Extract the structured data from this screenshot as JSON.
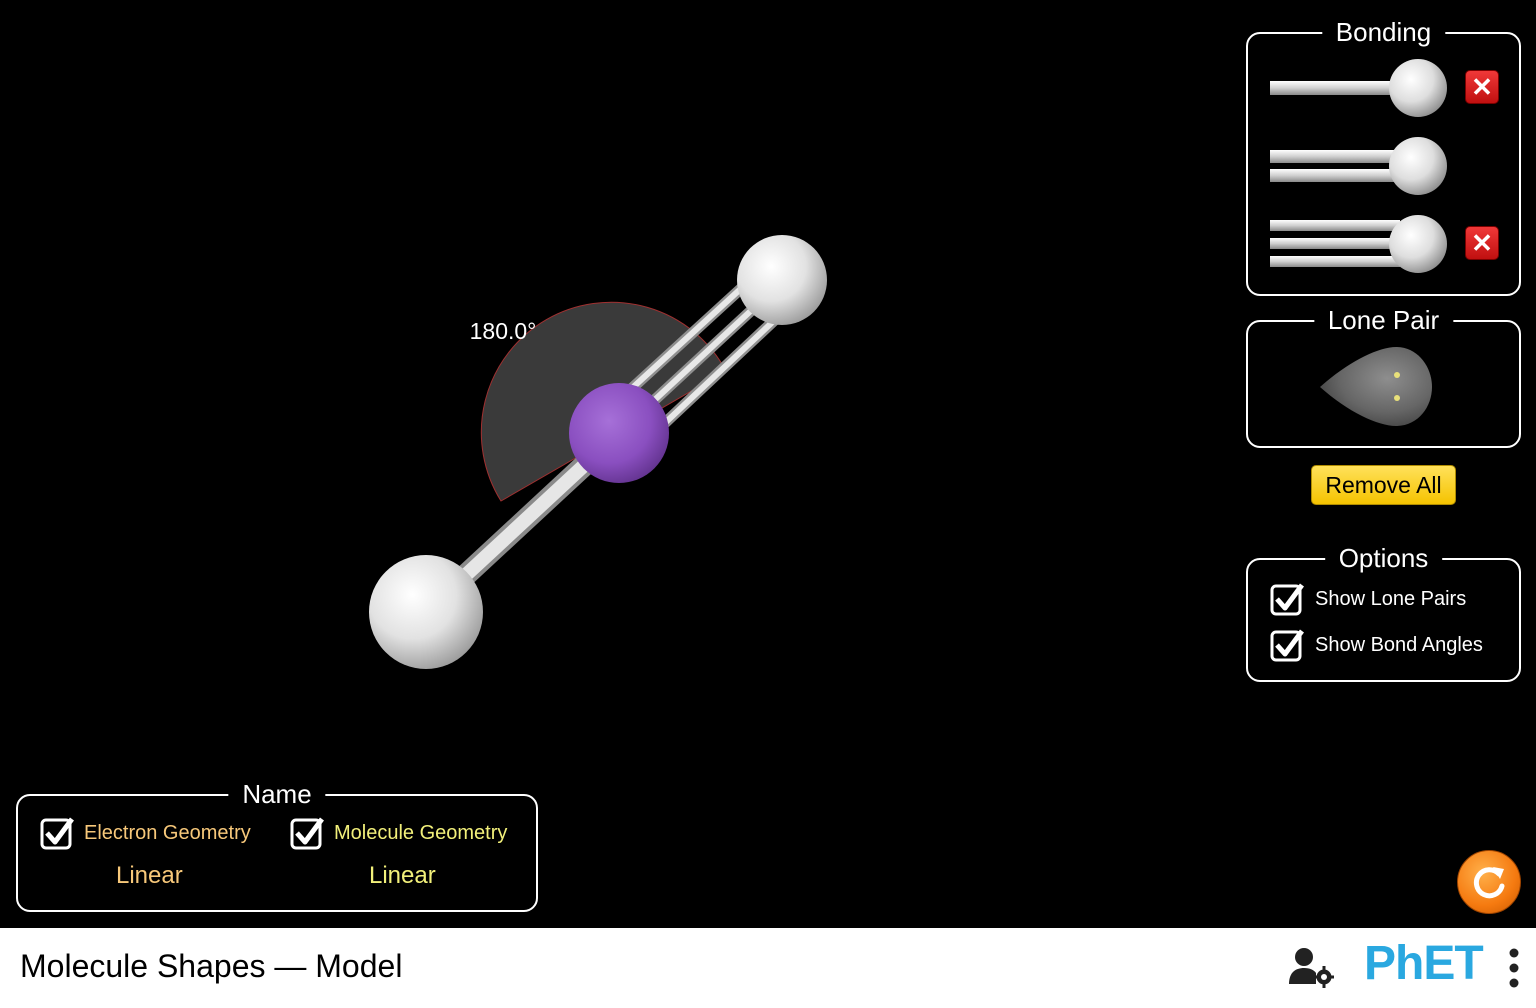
{
  "angle_label": "180.0°",
  "panels": {
    "bonding": {
      "title": "Bonding"
    },
    "lone_pair": {
      "title": "Lone Pair"
    },
    "options": {
      "title": "Options",
      "show_lone_pairs": "Show Lone Pairs",
      "show_bond_angles": "Show Bond Angles"
    },
    "name": {
      "title": "Name",
      "electron_geometry_label": "Electron Geometry",
      "molecule_geometry_label": "Molecule Geometry",
      "electron_geometry_value": "Linear",
      "molecule_geometry_value": "Linear"
    }
  },
  "buttons": {
    "remove_all": "Remove All",
    "remove_x": "✕"
  },
  "navbar": {
    "title": "Molecule Shapes — Model",
    "logo_text": "PhET"
  },
  "colors": {
    "electron_geometry": "#f7c87a",
    "molecule_geometry": "#f2f07a",
    "central_atom": "#8a4fc0",
    "outer_atom": "#e6e6e6",
    "remove_all": "#f5c300",
    "reset": "#f57a10"
  },
  "icons": {
    "remove": "close-icon",
    "checkbox": "checkbox-checked-icon",
    "reset": "reset-arrow-icon",
    "user": "user-gear-icon",
    "menu": "kebab-menu-icon"
  }
}
